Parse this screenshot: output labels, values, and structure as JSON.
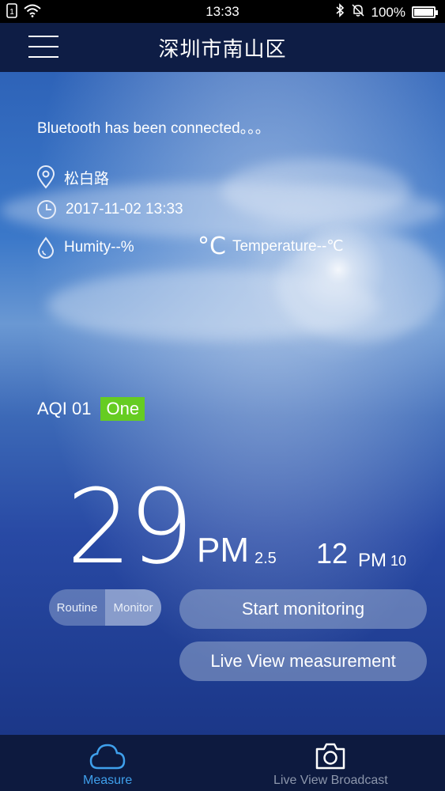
{
  "status_bar": {
    "time": "13:33",
    "battery": "100%",
    "battery_fill_fraction": 1.0,
    "icons": [
      "sim-icon",
      "wifi-icon",
      "bluetooth-icon",
      "mute-bell-icon",
      "battery-icon"
    ]
  },
  "header": {
    "title": "深圳市南山区",
    "menu_icon": "hamburger-menu-icon"
  },
  "connection": {
    "status": "Bluetooth has been connected。。。"
  },
  "info": {
    "location": "松白路",
    "datetime": "2017-11-02 13:33",
    "humidity": "Humity--%",
    "temperature_symbol": "°C",
    "temperature": "Temperature--℃"
  },
  "aqi": {
    "label": "AQI 01",
    "level": "One",
    "level_color": "#66cc22"
  },
  "readings": {
    "pm25_value": "29",
    "pm25_label": "PM",
    "pm25_sub": "2.5",
    "pm10_value": "12",
    "pm10_label": "PM",
    "pm10_sub": "10"
  },
  "mode_toggle": {
    "options": [
      "Routine",
      "Monitor"
    ],
    "active": "Monitor"
  },
  "buttons": {
    "start": "Start monitoring",
    "live_view": "Live View measurement"
  },
  "tabbar": {
    "tabs": [
      {
        "label": "Measure",
        "icon": "cloud-icon",
        "active": true,
        "color": "#3fa0ec"
      },
      {
        "label": "Live View Broadcast",
        "icon": "camera-icon",
        "active": false,
        "color": "#8c96ab"
      }
    ]
  }
}
